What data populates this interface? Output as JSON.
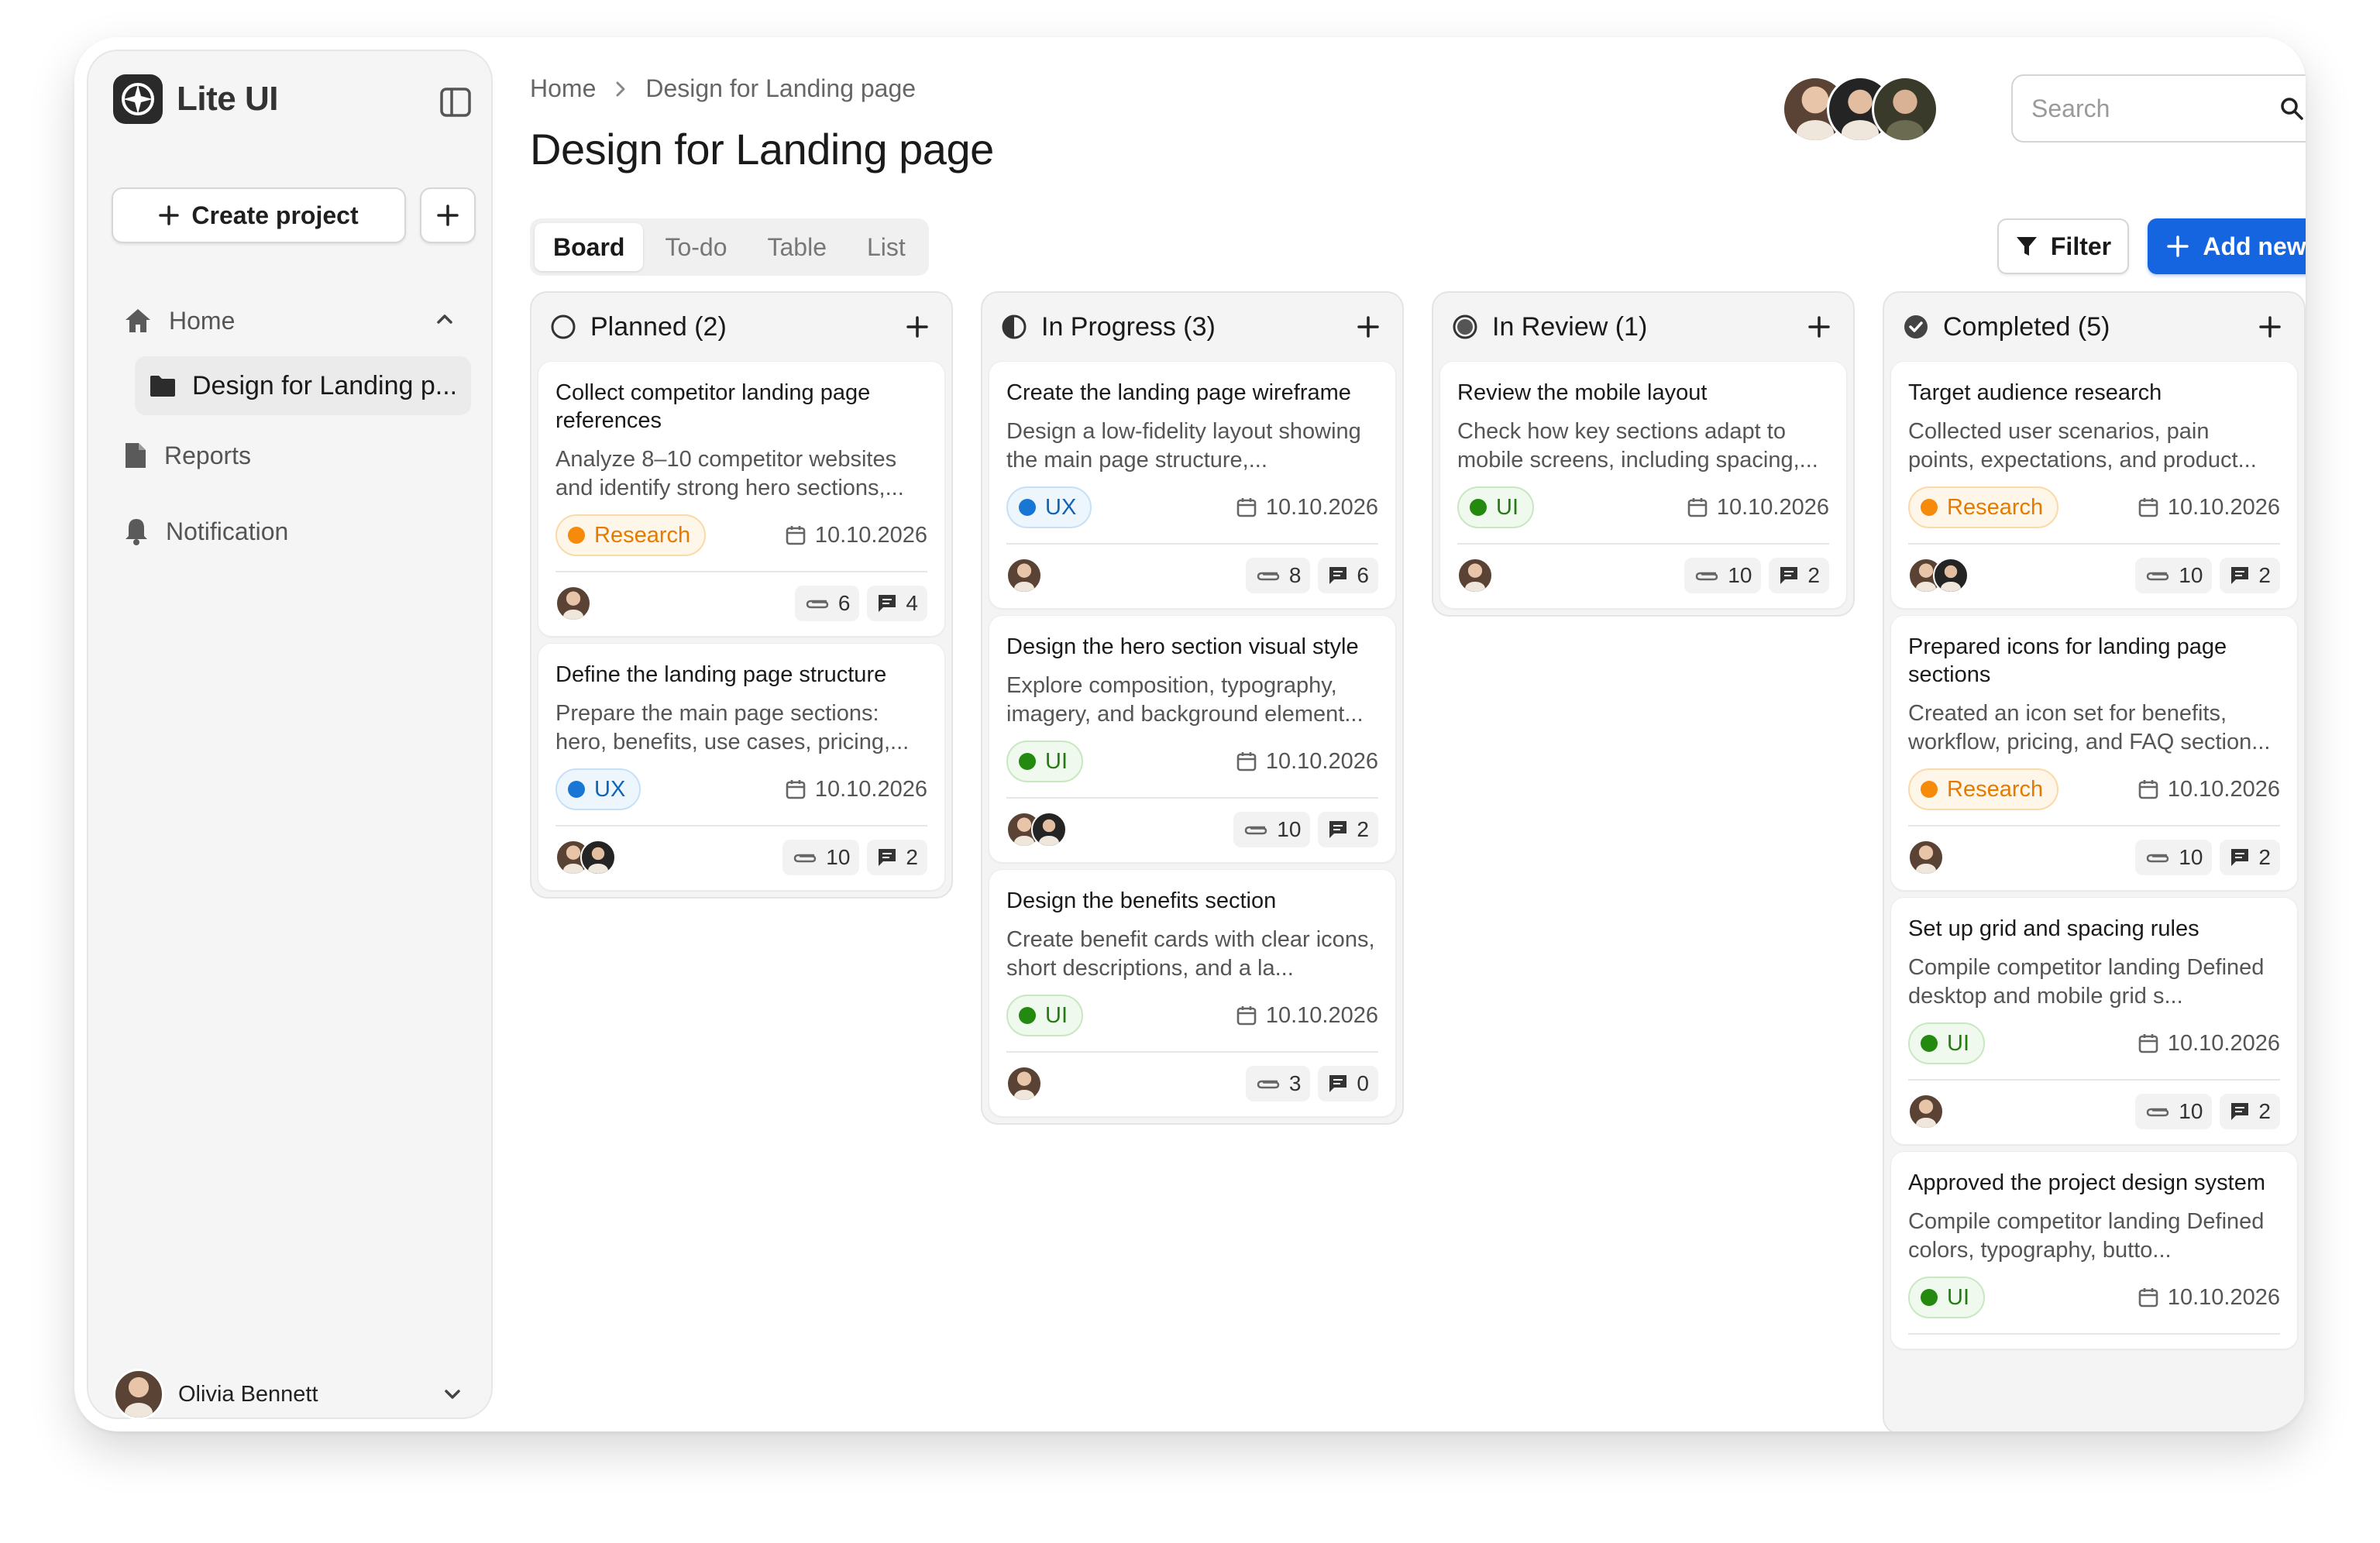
{
  "app": {
    "name": "Lite UI"
  },
  "sidebar": {
    "create_label": "Create project",
    "nav": {
      "home": "Home",
      "project": "Design for Landing p...",
      "reports": "Reports",
      "notification": "Notification"
    },
    "user": {
      "name": "Olivia Bennett"
    }
  },
  "header": {
    "breadcrumb": [
      "Home",
      "Design for Landing page"
    ],
    "title": "Design for Landing page",
    "search_placeholder": "Search"
  },
  "tabs": [
    "Board",
    "To-do",
    "Table",
    "List"
  ],
  "active_tab": "Board",
  "actions": {
    "filter": "Filter",
    "add_new": "Add new"
  },
  "colors": {
    "accent": "#1565e0",
    "research": "#f58a0b",
    "ux": "#1877d4",
    "ui": "#24890f"
  },
  "columns": [
    {
      "title": "Planned (2)",
      "status_icon": "circle-empty-icon",
      "cards": [
        {
          "title": "Collect competitor landing page references",
          "desc": "Analyze 8–10 competitor websites and identify strong hero sections,...",
          "tag": "Research",
          "date": "10.10.2026",
          "attachments": "6",
          "comments": "4",
          "people": 1
        },
        {
          "title": "Define the landing page structure",
          "desc": "Prepare the main page sections: hero, benefits, use cases, pricing,...",
          "tag": "UX",
          "date": "10.10.2026",
          "attachments": "10",
          "comments": "2",
          "people": 2
        }
      ]
    },
    {
      "title": "In Progress (3)",
      "status_icon": "circle-half-icon",
      "cards": [
        {
          "title": "Create the landing page wireframe",
          "desc": "Design a low-fidelity layout showing the main page structure,...",
          "tag": "UX",
          "date": "10.10.2026",
          "attachments": "8",
          "comments": "6",
          "people": 1
        },
        {
          "title": "Design the hero section visual style",
          "desc": "Explore composition, typography, imagery, and background element...",
          "tag": "UI",
          "date": "10.10.2026",
          "attachments": "10",
          "comments": "2",
          "people": 2
        },
        {
          "title": "Design the benefits section",
          "desc": "Create benefit cards with clear icons, short descriptions, and a la...",
          "tag": "UI",
          "date": "10.10.2026",
          "attachments": "3",
          "comments": "0",
          "people": 1
        }
      ]
    },
    {
      "title": "In Review (1)",
      "status_icon": "circle-filled-icon",
      "cards": [
        {
          "title": "Review the mobile layout",
          "desc": "Check how key sections adapt to mobile screens, including spacing,...",
          "tag": "UI",
          "date": "10.10.2026",
          "attachments": "10",
          "comments": "2",
          "people": 1
        }
      ]
    },
    {
      "title": "Completed (5)",
      "status_icon": "check-circle-icon",
      "cards": [
        {
          "title": "Target audience research",
          "desc": "Collected user scenarios, pain points, expectations, and product...",
          "tag": "Research",
          "date": "10.10.2026",
          "attachments": "10",
          "comments": "2",
          "people": 2
        },
        {
          "title": "Prepared icons for landing page sections",
          "desc": "Created an icon set for benefits, workflow, pricing, and FAQ section...",
          "tag": "Research",
          "date": "10.10.2026",
          "attachments": "10",
          "comments": "2",
          "people": 1
        },
        {
          "title": "Set up grid and spacing rules",
          "desc": "Compile competitor landing Defined desktop and mobile grid s...",
          "tag": "UI",
          "date": "10.10.2026",
          "attachments": "10",
          "comments": "2",
          "people": 1
        },
        {
          "title": "Approved the project design system",
          "desc": "Compile competitor landing Defined colors, typography, butto...",
          "tag": "UI",
          "date": "10.10.2026",
          "attachments": null,
          "comments": null,
          "people": 0
        }
      ]
    }
  ]
}
